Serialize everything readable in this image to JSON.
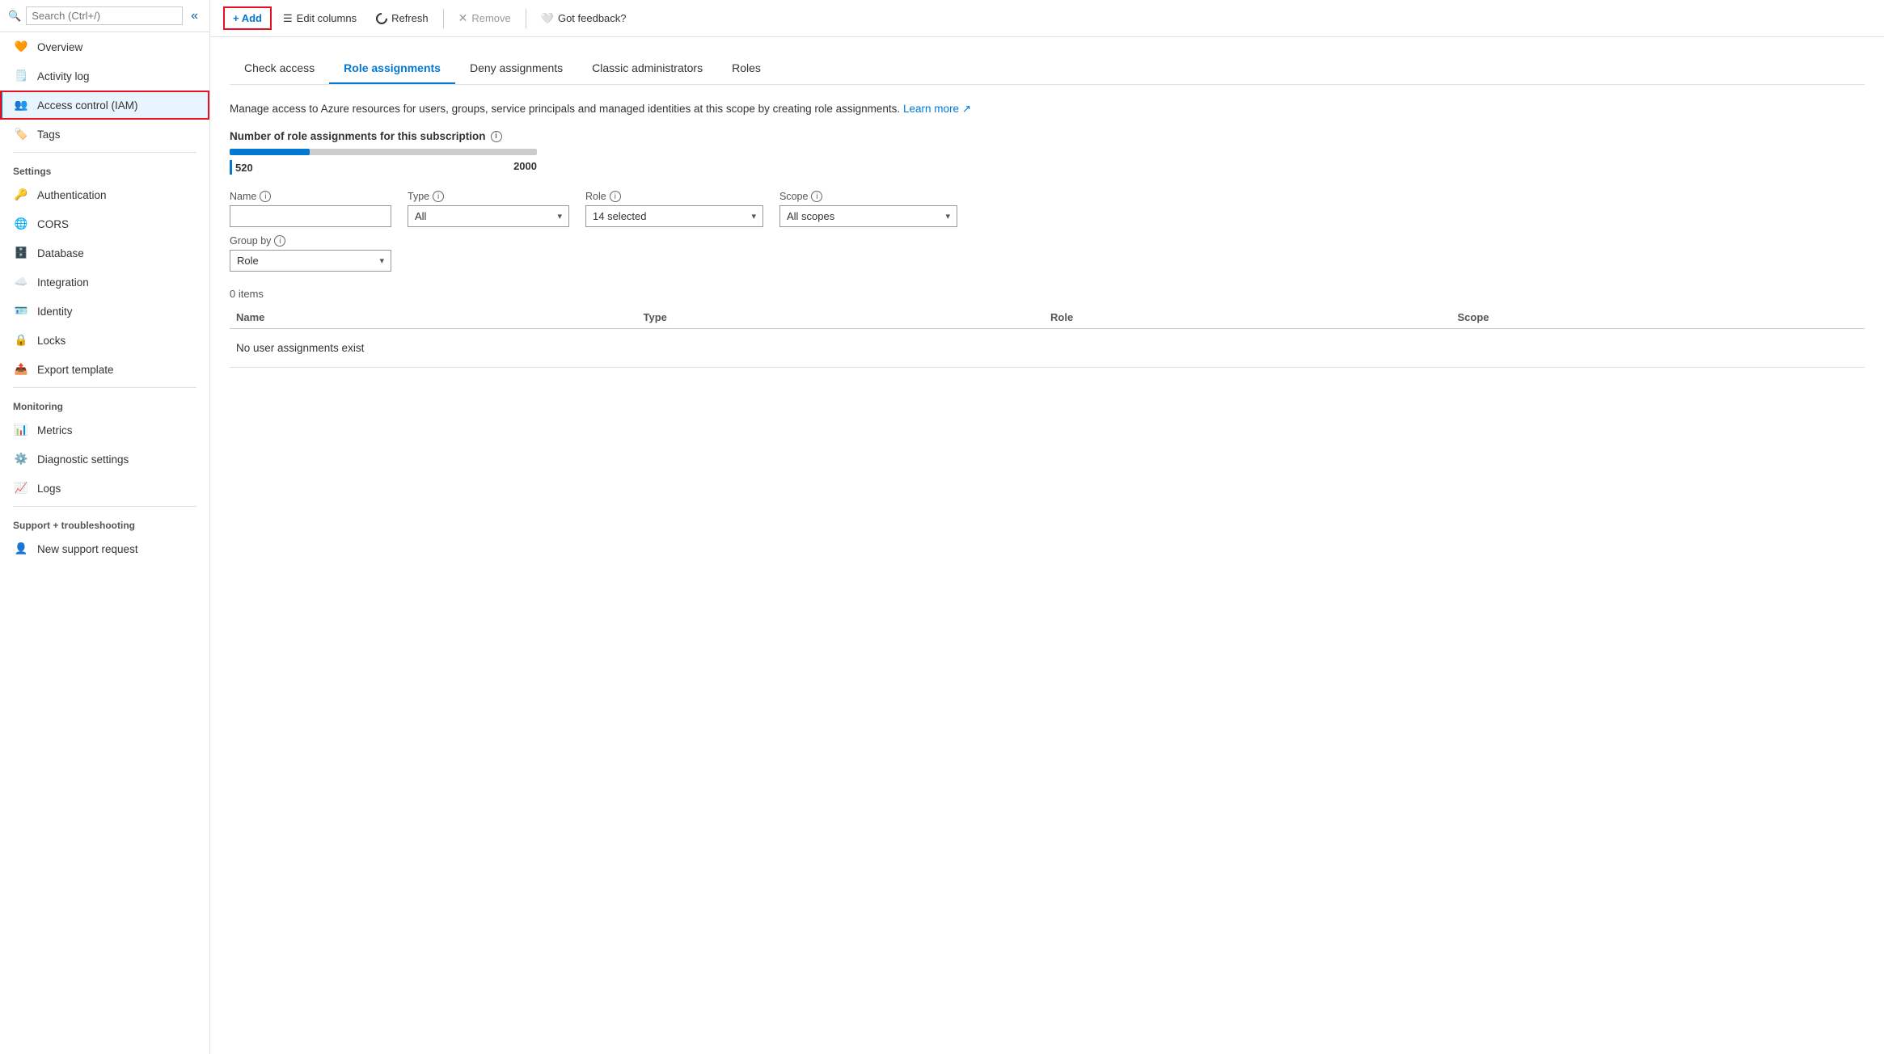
{
  "sidebar": {
    "search_placeholder": "Search (Ctrl+/)",
    "items": [
      {
        "id": "overview",
        "label": "Overview",
        "icon": "heart-icon",
        "icon_color": "orange",
        "active": false
      },
      {
        "id": "activity-log",
        "label": "Activity log",
        "icon": "doc-icon",
        "icon_color": "blue",
        "active": false
      },
      {
        "id": "access-control",
        "label": "Access control (IAM)",
        "icon": "people-icon",
        "icon_color": "blue",
        "active": true
      },
      {
        "id": "tags",
        "label": "Tags",
        "icon": "tag-icon",
        "icon_color": "purple",
        "active": false
      }
    ],
    "sections": [
      {
        "label": "Settings",
        "items": [
          {
            "id": "authentication",
            "label": "Authentication",
            "icon": "key-icon",
            "icon_color": "blue"
          },
          {
            "id": "cors",
            "label": "CORS",
            "icon": "globe-icon",
            "icon_color": "green"
          },
          {
            "id": "database",
            "label": "Database",
            "icon": "db-icon",
            "icon_color": "blue"
          },
          {
            "id": "integration",
            "label": "Integration",
            "icon": "cloud-icon",
            "icon_color": "blue"
          },
          {
            "id": "identity",
            "label": "Identity",
            "icon": "id-icon",
            "icon_color": "yellow"
          },
          {
            "id": "locks",
            "label": "Locks",
            "icon": "lock-icon",
            "icon_color": "gray"
          },
          {
            "id": "export-template",
            "label": "Export template",
            "icon": "export-icon",
            "icon_color": "blue"
          }
        ]
      },
      {
        "label": "Monitoring",
        "items": [
          {
            "id": "metrics",
            "label": "Metrics",
            "icon": "metrics-icon",
            "icon_color": "purple"
          },
          {
            "id": "diagnostic-settings",
            "label": "Diagnostic settings",
            "icon": "diag-icon",
            "icon_color": "green"
          },
          {
            "id": "logs",
            "label": "Logs",
            "icon": "logs-icon",
            "icon_color": "blue"
          }
        ]
      },
      {
        "label": "Support + troubleshooting",
        "items": [
          {
            "id": "new-support-request",
            "label": "New support request",
            "icon": "support-icon",
            "icon_color": "blue"
          }
        ]
      }
    ]
  },
  "toolbar": {
    "add_label": "+ Add",
    "edit_columns_label": "Edit columns",
    "refresh_label": "Refresh",
    "remove_label": "Remove",
    "feedback_label": "Got feedback?"
  },
  "tabs": [
    {
      "id": "check-access",
      "label": "Check access",
      "active": false
    },
    {
      "id": "role-assignments",
      "label": "Role assignments",
      "active": true
    },
    {
      "id": "deny-assignments",
      "label": "Deny assignments",
      "active": false
    },
    {
      "id": "classic-administrators",
      "label": "Classic administrators",
      "active": false
    },
    {
      "id": "roles",
      "label": "Roles",
      "active": false
    }
  ],
  "content": {
    "description": "Manage access to Azure resources for users, groups, service principals and managed identities at this scope by creating role assignments.",
    "learn_more": "Learn more",
    "count_section": {
      "label": "Number of role assignments for this subscription",
      "current": 520,
      "max": 2000,
      "progress_percent": 26
    },
    "filters": {
      "name_label": "Name",
      "name_placeholder": "",
      "type_label": "Type",
      "type_value": "All",
      "role_label": "Role",
      "role_value": "14 selected",
      "scope_label": "Scope",
      "scope_value": "All scopes",
      "group_by_label": "Group by",
      "group_by_value": "Role"
    },
    "table": {
      "items_count": "0 items",
      "columns": [
        "Name",
        "Type",
        "Role",
        "Scope"
      ],
      "empty_message": "No user assignments exist"
    }
  }
}
